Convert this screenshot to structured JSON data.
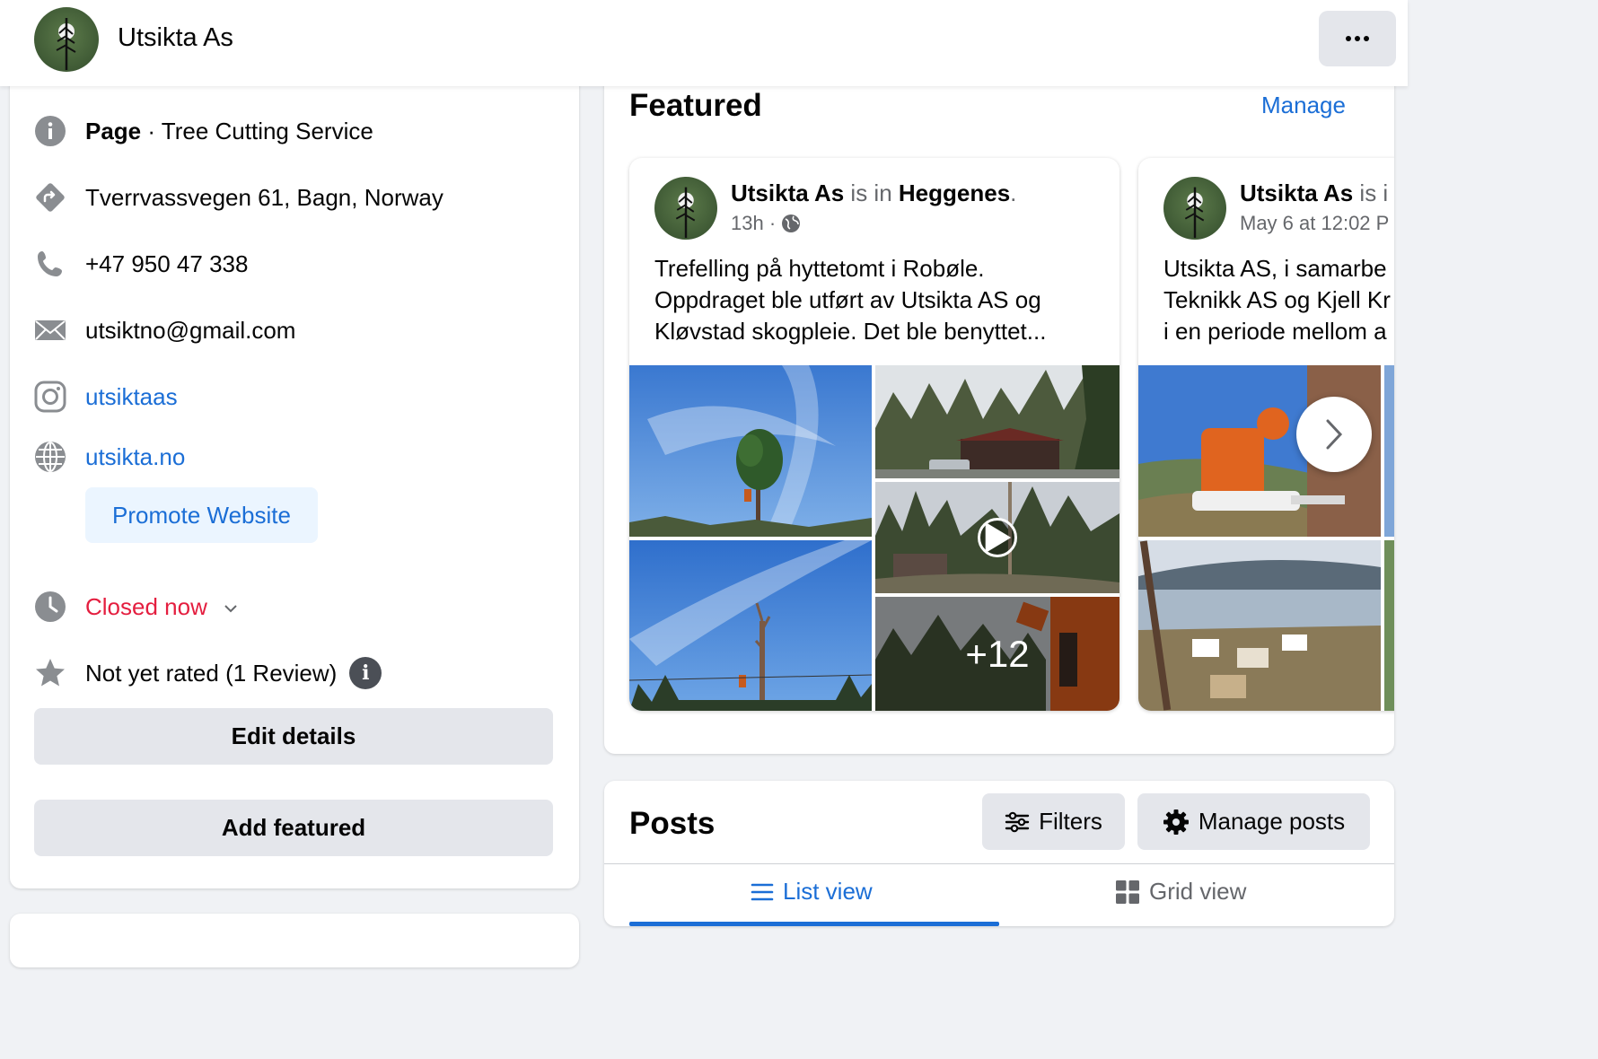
{
  "header": {
    "page_name": "Utsikta As"
  },
  "intro": {
    "category_label": "Page",
    "category_separator": " · ",
    "category_value": "Tree Cutting Service",
    "address": "Tverrvassvegen 61, Bagn, Norway",
    "phone": "+47 950 47 338",
    "email": "utsiktno@gmail.com",
    "instagram": "utsiktaas",
    "website": "utsikta.no",
    "promote_website_label": "Promote Website",
    "hours_status": "Closed now",
    "rating": "Not yet rated (1 Review)",
    "edit_details_label": "Edit details",
    "add_featured_label": "Add featured"
  },
  "featured": {
    "title": "Featured",
    "manage_label": "Manage",
    "posts": [
      {
        "author": "Utsikta As",
        "connector": " is in ",
        "location": "Heggenes",
        "location_suffix": ".",
        "time": "13h · ",
        "text": "Trefelling på hyttetomt i Robøle.\nOppdraget ble utført av Utsikta AS og\nKløvstad skogpleie. Det ble benyttet...",
        "more_photos": "+12"
      },
      {
        "author": "Utsikta As",
        "connector": " is i",
        "time": "May 6 at 12:02 P",
        "text": "Utsikta AS, i samarbe\nTeknikk AS og Kjell Kr\ni en periode mellom a"
      }
    ]
  },
  "posts_section": {
    "title": "Posts",
    "filters_label": "Filters",
    "manage_posts_label": "Manage posts",
    "list_view_label": "List view",
    "grid_view_label": "Grid view"
  },
  "colors": {
    "accent": "#1b6ed6",
    "closed": "#e41e3f",
    "button_gray": "#e4e6eb",
    "background": "#f0f2f5"
  },
  "icons": {
    "category": "info-circle-icon",
    "address": "directions-icon",
    "phone": "phone-icon",
    "email": "envelope-icon",
    "instagram": "instagram-icon",
    "website": "globe-icon",
    "hours": "clock-icon",
    "rating": "star-icon",
    "audience": "globe-small-icon",
    "filters": "sliders-icon",
    "manage_posts": "gear-icon",
    "list_view": "list-icon",
    "grid_view": "grid-icon",
    "next": "chevron-right-icon",
    "video": "play-icon"
  }
}
